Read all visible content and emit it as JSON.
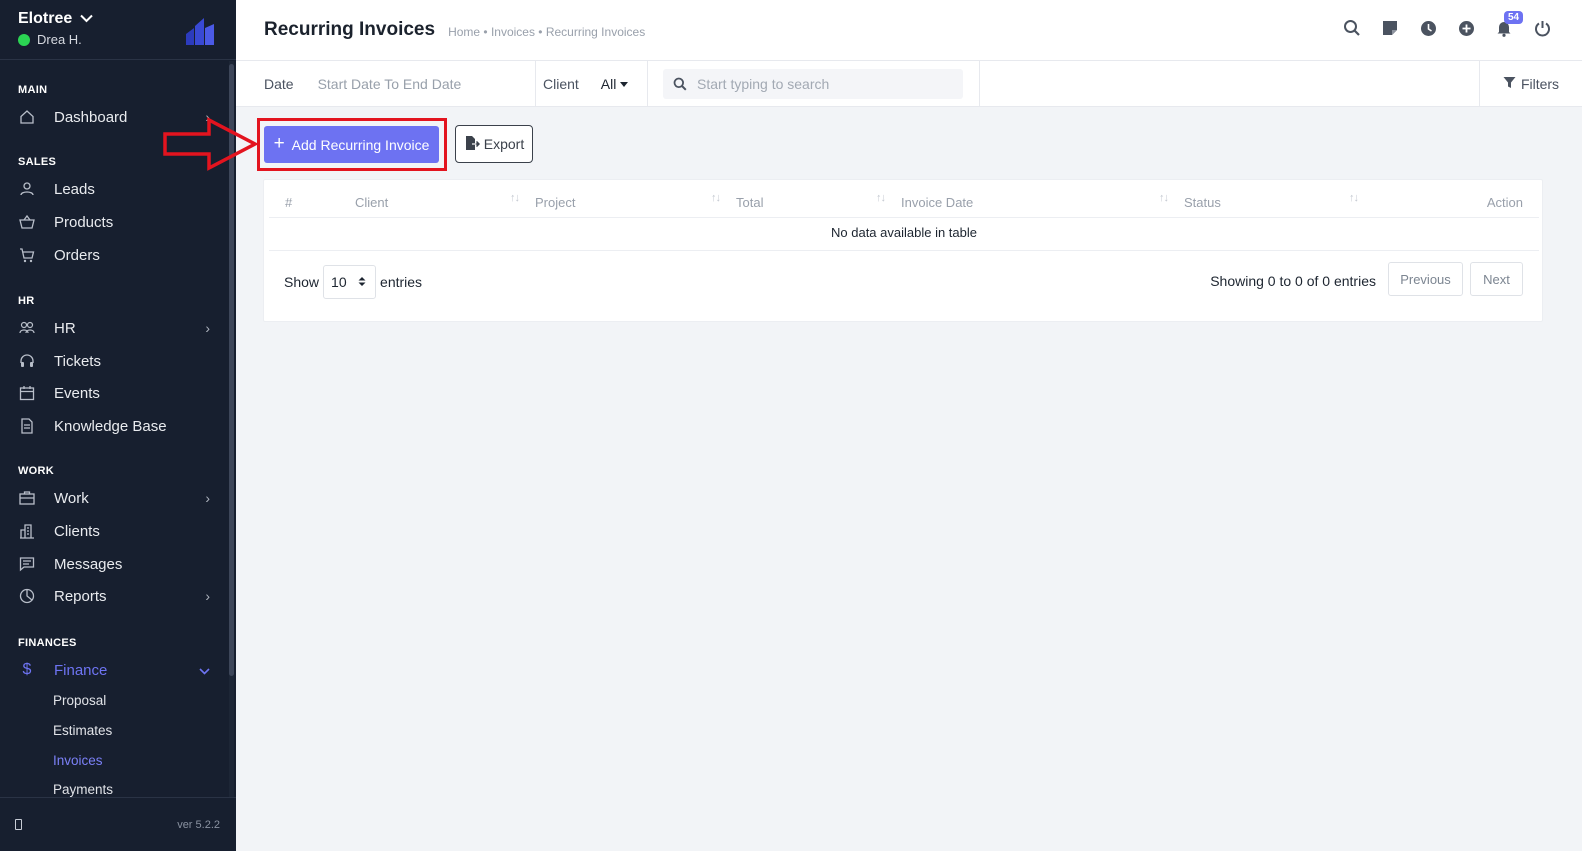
{
  "sidebar": {
    "company": "Elotree",
    "user": "Drea H.",
    "sections": {
      "main": "MAIN",
      "sales": "SALES",
      "hr": "HR",
      "work": "WORK",
      "finances": "FINANCES"
    },
    "items": {
      "dashboard": "Dashboard",
      "leads": "Leads",
      "products": "Products",
      "orders": "Orders",
      "hr": "HR",
      "tickets": "Tickets",
      "events": "Events",
      "knowledge_base": "Knowledge Base",
      "work": "Work",
      "clients": "Clients",
      "messages": "Messages",
      "reports": "Reports",
      "finance": "Finance"
    },
    "finance_sub": {
      "proposal": "Proposal",
      "estimates": "Estimates",
      "invoices": "Invoices",
      "payments": "Payments"
    },
    "version": "ver 5.2.2",
    "accent": "#6e74f3"
  },
  "header": {
    "title": "Recurring Invoices",
    "breadcrumb": "Home • Invoices • Recurring Invoices",
    "notification_count": "54"
  },
  "filters": {
    "date_label": "Date",
    "date_value": "Start Date To End Date",
    "client_label": "Client",
    "client_value": "All",
    "search_placeholder": "Start typing to search",
    "filters_label": "Filters"
  },
  "actions": {
    "add_label": "Add Recurring Invoice",
    "export_label": "Export"
  },
  "table": {
    "columns": [
      "#",
      "Client",
      "Project",
      "Total",
      "Invoice Date",
      "Status",
      "Action"
    ],
    "empty_message": "No data available in table",
    "show_label": "Show",
    "page_length": "10",
    "entries_label": "entries",
    "info": "Showing 0 to 0 of 0 entries",
    "previous": "Previous",
    "next": "Next"
  }
}
